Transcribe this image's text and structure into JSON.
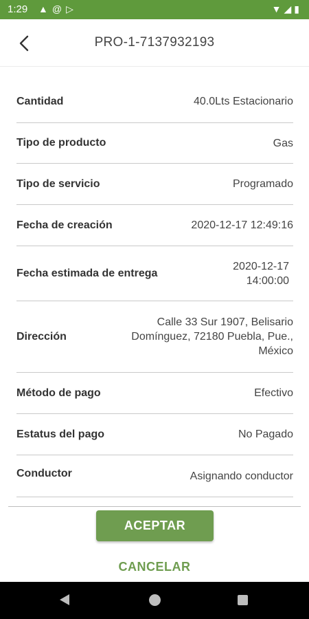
{
  "status_bar": {
    "time": "1:29",
    "left_icons": [
      "warning-icon",
      "at-sign-icon",
      "play-store-icon"
    ],
    "right_icons": [
      "wifi-icon",
      "signal-icon",
      "battery-icon"
    ]
  },
  "header": {
    "title": "PRO-1-7137932193",
    "back_icon": "arrow-back-icon"
  },
  "details": [
    {
      "label": "Cantidad",
      "value": "40.0Lts Estacionario"
    },
    {
      "label": "Tipo de producto",
      "value": "Gas"
    },
    {
      "label": "Tipo de servicio",
      "value": "Programado"
    },
    {
      "label": "Fecha de creación",
      "value": "2020-12-17 12:49:16"
    },
    {
      "label": "Fecha estimada de entrega",
      "value_line1": "2020-12-17",
      "value_line2": "14:00:00"
    },
    {
      "label": "Dirección",
      "value_line1": "Calle 33 Sur 1907, Belisario",
      "value_line2": "Domínguez, 72180 Puebla, Pue.,",
      "value_line3": "México"
    },
    {
      "label": "Método de pago",
      "value": "Efectivo"
    },
    {
      "label": "Estatus del pago",
      "value": "No Pagado"
    },
    {
      "label": "Conductor",
      "value": "Asignando conductor"
    }
  ],
  "actions": {
    "accept_label": "ACEPTAR",
    "cancel_label": "CANCELAR"
  },
  "colors": {
    "status_bar": "#5f9a3c",
    "accent": "#6f9d50"
  }
}
